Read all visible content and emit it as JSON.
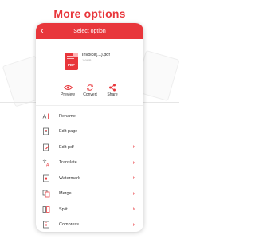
{
  "banner": {
    "title": "More options"
  },
  "topbar": {
    "title": "Select option",
    "back_icon": "back-arrow-icon"
  },
  "file": {
    "icon_label": "PDF",
    "name": "Invoice(...).pdf",
    "info": "1.6MB"
  },
  "actions": [
    {
      "label": "Preview",
      "icon": "eye-icon"
    },
    {
      "label": "Convert",
      "icon": "convert-icon"
    },
    {
      "label": "Share",
      "icon": "share-icon"
    }
  ],
  "menu": [
    {
      "label": "Rename",
      "icon": "rename-icon",
      "chevron": false
    },
    {
      "label": "Edit page",
      "icon": "edit-page-icon",
      "chevron": false
    },
    {
      "label": "Edit pdf",
      "icon": "edit-pdf-icon",
      "chevron": true
    },
    {
      "label": "Translate",
      "icon": "translate-icon",
      "chevron": true
    },
    {
      "label": "Watermark",
      "icon": "watermark-icon",
      "chevron": true
    },
    {
      "label": "Merge",
      "icon": "merge-icon",
      "chevron": true
    },
    {
      "label": "Split",
      "icon": "split-icon",
      "chevron": true
    },
    {
      "label": "Compress",
      "icon": "compress-icon",
      "chevron": true
    }
  ],
  "colors": {
    "accent": "#e8363b"
  }
}
